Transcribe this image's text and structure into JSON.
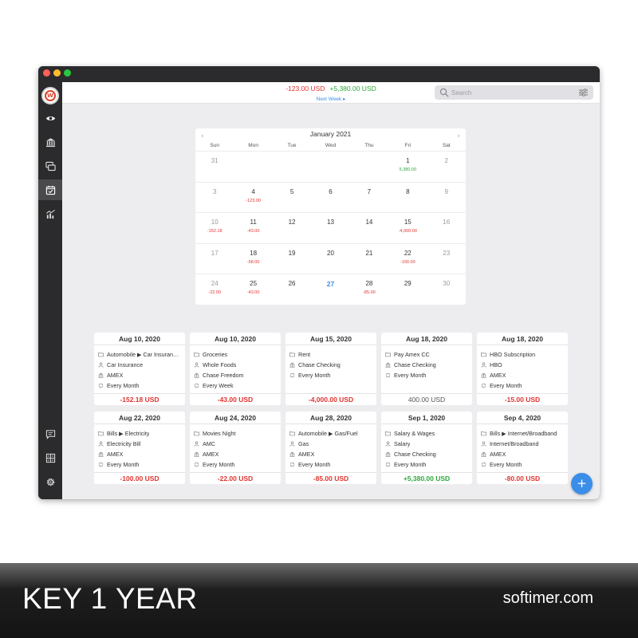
{
  "toolbar": {
    "total_expense": "-123.00 USD",
    "total_income": "+5,380.00 USD",
    "next_week_label": "Next Week ▸"
  },
  "search": {
    "placeholder": "Search"
  },
  "sidebar": {
    "items": [
      {
        "icon": "eye-icon",
        "active": false
      },
      {
        "icon": "bank-icon",
        "active": false
      },
      {
        "icon": "stacked-cards-icon",
        "active": false
      },
      {
        "icon": "calendar-check-icon",
        "active": true
      },
      {
        "icon": "chart-icon",
        "active": false
      }
    ],
    "bottom_items": [
      {
        "icon": "chat-icon"
      },
      {
        "icon": "grid-icon"
      },
      {
        "icon": "gear-icon"
      }
    ]
  },
  "calendar": {
    "month_label": "January 2021",
    "weekdays": [
      "Sun",
      "Mon",
      "Tue",
      "Wed",
      "Thu",
      "Fri",
      "Sat"
    ],
    "weeks": [
      [
        {
          "d": "31",
          "other": true
        },
        {
          "d": ""
        },
        {
          "d": ""
        },
        {
          "d": ""
        },
        {
          "d": ""
        },
        {
          "d": "1",
          "amt": "5,380.00",
          "type": "pos"
        },
        {
          "d": "2",
          "other": true
        }
      ],
      [
        {
          "d": "3",
          "other": true
        },
        {
          "d": "4",
          "amt": "-123.00",
          "type": "neg"
        },
        {
          "d": "5"
        },
        {
          "d": "6"
        },
        {
          "d": "7"
        },
        {
          "d": "8"
        },
        {
          "d": "9",
          "other": true
        }
      ],
      [
        {
          "d": "10",
          "other": true,
          "amt": "-152.18",
          "type": "neg"
        },
        {
          "d": "11",
          "amt": "-43.00",
          "type": "neg"
        },
        {
          "d": "12"
        },
        {
          "d": "13"
        },
        {
          "d": "14"
        },
        {
          "d": "15",
          "amt": "-4,000.00",
          "type": "neg"
        },
        {
          "d": "16",
          "other": true
        }
      ],
      [
        {
          "d": "17",
          "other": true
        },
        {
          "d": "18",
          "amt": "-58.00",
          "type": "neg"
        },
        {
          "d": "19"
        },
        {
          "d": "20"
        },
        {
          "d": "21"
        },
        {
          "d": "22",
          "amt": "-100.00",
          "type": "neg"
        },
        {
          "d": "23",
          "other": true
        }
      ],
      [
        {
          "d": "24",
          "other": true,
          "amt": "-22.00",
          "type": "neg"
        },
        {
          "d": "25",
          "amt": "-43.00",
          "type": "neg"
        },
        {
          "d": "26"
        },
        {
          "d": "27",
          "today": true
        },
        {
          "d": "28",
          "amt": "-85.00",
          "type": "neg"
        },
        {
          "d": "29"
        },
        {
          "d": "30",
          "other": true
        }
      ]
    ]
  },
  "transactions": [
    {
      "date": "Aug 10, 2020",
      "lines": [
        {
          "icon": "folder-icon",
          "text": "Automobile ▶ Car Insuran…"
        },
        {
          "icon": "payee-icon",
          "text": "Car Insurance"
        },
        {
          "icon": "bank-icon",
          "text": "AMEX"
        },
        {
          "icon": "repeat-icon",
          "text": "Every Month"
        }
      ],
      "amount": "-152.18 USD",
      "type": "neg"
    },
    {
      "date": "Aug 10, 2020",
      "lines": [
        {
          "icon": "folder-icon",
          "text": "Groceries"
        },
        {
          "icon": "payee-icon",
          "text": "Whole Foods"
        },
        {
          "icon": "bank-icon",
          "text": "Chase Freedom"
        },
        {
          "icon": "repeat-icon",
          "text": "Every Week"
        }
      ],
      "amount": "-43.00 USD",
      "type": "neg"
    },
    {
      "date": "Aug 15, 2020",
      "lines": [
        {
          "icon": "folder-icon",
          "text": "Rent"
        },
        {
          "icon": "bank-icon",
          "text": "Chase Checking"
        },
        {
          "icon": "repeat-icon",
          "text": "Every Month"
        }
      ],
      "amount": "-4,000.00 USD",
      "type": "neg"
    },
    {
      "date": "Aug 18, 2020",
      "lines": [
        {
          "icon": "folder-icon",
          "text": "Pay Amex CC"
        },
        {
          "icon": "bank-icon",
          "text": "Chase Checking"
        },
        {
          "icon": "repeat-icon",
          "text": "Every Month"
        }
      ],
      "amount": "400.00 USD",
      "type": "neutral"
    },
    {
      "date": "Aug 18, 2020",
      "lines": [
        {
          "icon": "folder-icon",
          "text": "HBO Subscription"
        },
        {
          "icon": "payee-icon",
          "text": "HBO"
        },
        {
          "icon": "bank-icon",
          "text": "AMEX"
        },
        {
          "icon": "repeat-icon",
          "text": "Every Month"
        }
      ],
      "amount": "-15.00 USD",
      "type": "neg"
    },
    {
      "date": "Aug 22, 2020",
      "lines": [
        {
          "icon": "folder-icon",
          "text": "Bills ▶ Electricity"
        },
        {
          "icon": "payee-icon",
          "text": "Electricity Bill"
        },
        {
          "icon": "bank-icon",
          "text": "AMEX"
        },
        {
          "icon": "repeat-icon",
          "text": "Every Month"
        }
      ],
      "amount": "-100.00 USD",
      "type": "neg"
    },
    {
      "date": "Aug 24, 2020",
      "lines": [
        {
          "icon": "folder-icon",
          "text": "Movies Night"
        },
        {
          "icon": "payee-icon",
          "text": "AMC"
        },
        {
          "icon": "bank-icon",
          "text": "AMEX"
        },
        {
          "icon": "repeat-icon",
          "text": "Every Month"
        }
      ],
      "amount": "-22.00 USD",
      "type": "neg"
    },
    {
      "date": "Aug 28, 2020",
      "lines": [
        {
          "icon": "folder-icon",
          "text": "Automobile ▶ Gas/Fuel"
        },
        {
          "icon": "payee-icon",
          "text": "Gas"
        },
        {
          "icon": "bank-icon",
          "text": "AMEX"
        },
        {
          "icon": "repeat-icon",
          "text": "Every Month"
        }
      ],
      "amount": "-85.00 USD",
      "type": "neg"
    },
    {
      "date": "Sep 1, 2020",
      "lines": [
        {
          "icon": "folder-icon",
          "text": "Salary & Wages"
        },
        {
          "icon": "payee-icon",
          "text": "Salary"
        },
        {
          "icon": "bank-icon",
          "text": "Chase Checking"
        },
        {
          "icon": "repeat-icon",
          "text": "Every Month"
        }
      ],
      "amount": "+5,380.00 USD",
      "type": "pos"
    },
    {
      "date": "Sep 4, 2020",
      "lines": [
        {
          "icon": "folder-icon",
          "text": "Bills ▶ Internet/Broadband"
        },
        {
          "icon": "payee-icon",
          "text": "Internet/Broadband"
        },
        {
          "icon": "bank-icon",
          "text": "AMEX"
        },
        {
          "icon": "repeat-icon",
          "text": "Every Month"
        }
      ],
      "amount": "-80.00 USD",
      "type": "neg"
    }
  ],
  "add_button": {
    "label": "+"
  },
  "banner": {
    "left_text": "KEY 1 YEAR",
    "right_text": "softimer.com"
  },
  "colors": {
    "accent": "#3b8ee8",
    "negative": "#e0332f",
    "positive": "#2ca83a",
    "sidebar": "#2b2b2d"
  }
}
